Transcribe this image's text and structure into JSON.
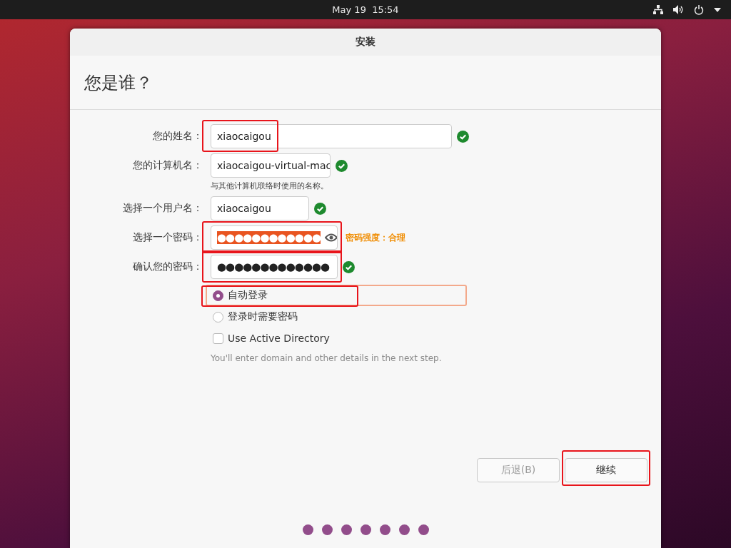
{
  "top_bar": {
    "clock": "May 19  15:54"
  },
  "window": {
    "title": "安装"
  },
  "page_heading": "您是谁？",
  "fields": [
    {
      "label": "您的姓名：",
      "kind": "text",
      "value": "xiaocaigou",
      "valid": true,
      "annotated": true
    },
    {
      "label": "您的计算机名：",
      "kind": "text",
      "value": "xiaocaigou-virtual-mac",
      "valid": true,
      "annotated": false,
      "hint": "与其他计算机联络时使用的名称。"
    },
    {
      "label": "选择一个用户名：",
      "kind": "text",
      "value": "xiaocaigou",
      "valid": true,
      "annotated": false
    },
    {
      "label": "选择一个密码：",
      "kind": "password",
      "value": "●●●●●●●●●●●●",
      "selected_text": true,
      "valid": false,
      "strength": "密码强度：合理",
      "annotated": true
    },
    {
      "label": "确认您的密码：",
      "kind": "password",
      "value": "●●●●●●●●●●●●●",
      "selected_text": false,
      "valid": true,
      "annotated": true
    }
  ],
  "login_options": [
    {
      "label": "自动登录",
      "kind": "radio",
      "selected": true,
      "focused": true,
      "annotated": true
    },
    {
      "label": "登录时需要密码",
      "kind": "radio",
      "selected": false,
      "focused": false,
      "annotated": false
    },
    {
      "label": "Use Active Directory",
      "kind": "checkbox",
      "checked": false,
      "focused": false,
      "annotated": false
    }
  ],
  "login_hint": "You'll enter domain and other details in the next step.",
  "buttons": [
    {
      "label": "后退(B)",
      "disabled": true,
      "annotated": false
    },
    {
      "label": "继续",
      "disabled": false,
      "annotated": true
    }
  ],
  "steps": [
    {
      "kind": "dot"
    },
    {
      "kind": "dot"
    },
    {
      "kind": "dot"
    },
    {
      "kind": "dot"
    },
    {
      "kind": "dot"
    },
    {
      "kind": "dot"
    },
    {
      "kind": "dot"
    }
  ]
}
